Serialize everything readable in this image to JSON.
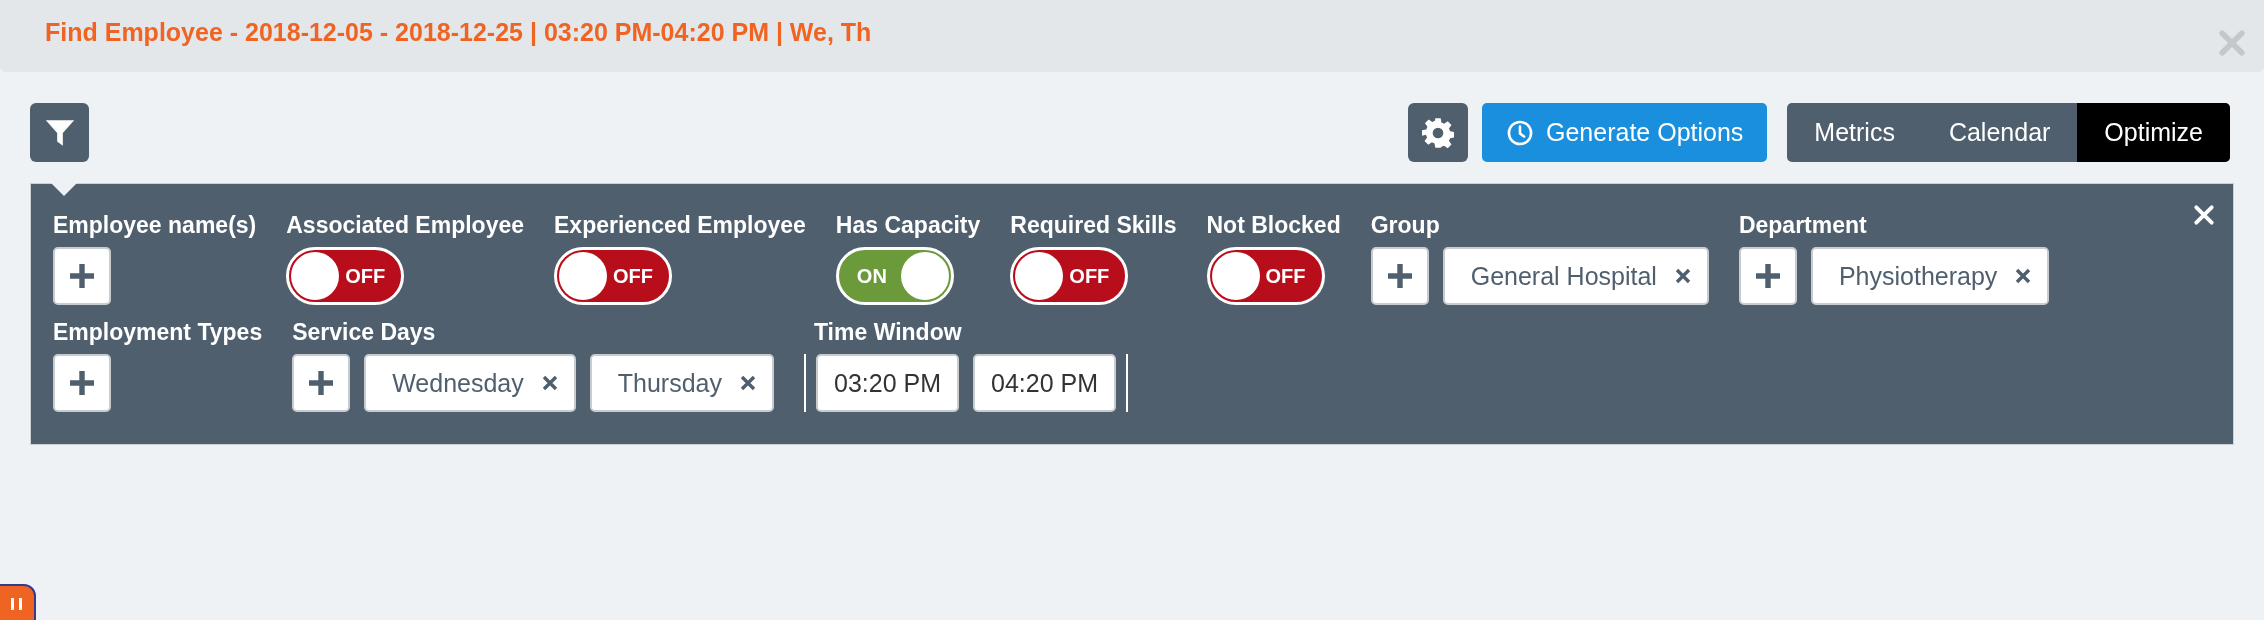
{
  "header": {
    "title": "Find Employee - 2018-12-05 - 2018-12-25 | 03:20 PM-04:20 PM | We, Th"
  },
  "toolbar": {
    "generate_button": "Generate Options",
    "tabs": [
      {
        "label": "Metrics",
        "selected": false
      },
      {
        "label": "Calendar",
        "selected": false
      },
      {
        "label": "Optimize",
        "selected": true
      }
    ]
  },
  "filters": {
    "rows": [
      {
        "fields": [
          {
            "kind": "add",
            "label": "Employee name(s)"
          },
          {
            "kind": "toggle",
            "label": "Associated Employee",
            "on": false,
            "text": "OFF"
          },
          {
            "kind": "toggle",
            "label": "Experienced Employee",
            "on": false,
            "text": "OFF"
          },
          {
            "kind": "toggle",
            "label": "Has Capacity",
            "on": true,
            "text": "ON"
          },
          {
            "kind": "toggle",
            "label": "Required Skills",
            "on": false,
            "text": "OFF"
          },
          {
            "kind": "toggle",
            "label": "Not Blocked",
            "on": false,
            "text": "OFF"
          },
          {
            "kind": "chips",
            "label": "Group",
            "chips": [
              "General Hospital"
            ]
          },
          {
            "kind": "chips",
            "label": "Department",
            "chips": [
              "Physiotherapy"
            ]
          }
        ]
      },
      {
        "fields": [
          {
            "kind": "add",
            "label": "Employment Types"
          },
          {
            "kind": "chips",
            "label": "Service Days",
            "chips": [
              "Wednesday",
              "Thursday"
            ]
          },
          {
            "kind": "time",
            "label": "Time Window",
            "values": [
              "03:20 PM",
              "04:20 PM"
            ]
          }
        ]
      }
    ]
  }
}
